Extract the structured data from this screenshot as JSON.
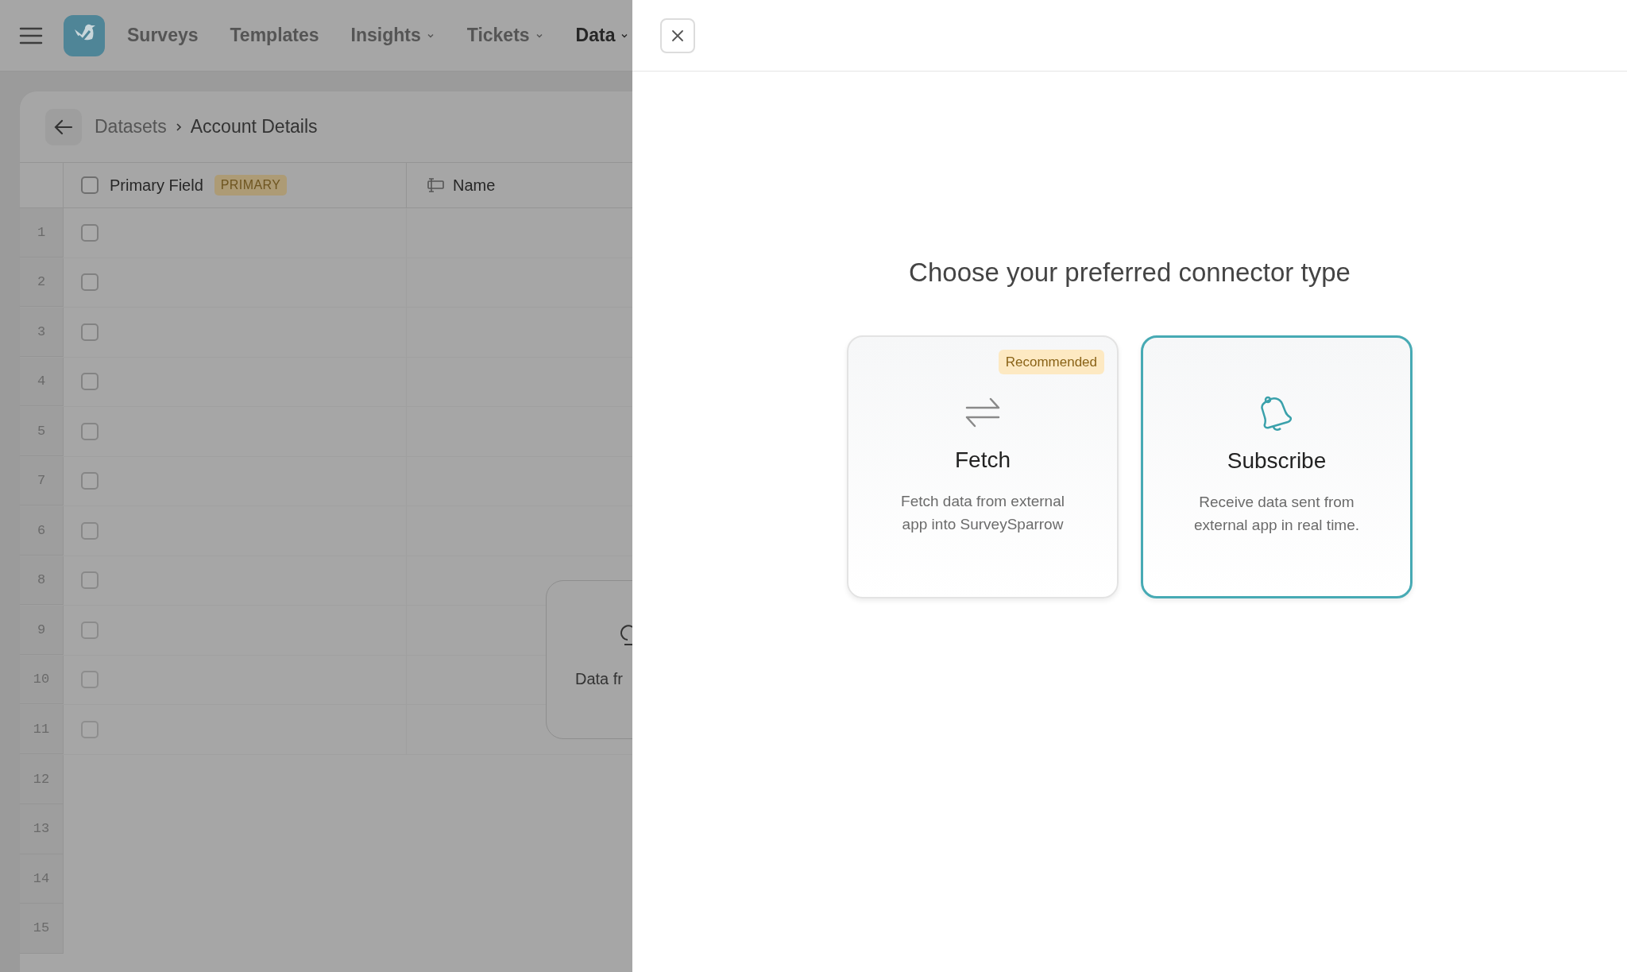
{
  "nav": {
    "items": [
      {
        "label": "Surveys",
        "selected": false,
        "dropdown": false
      },
      {
        "label": "Templates",
        "selected": false,
        "dropdown": false
      },
      {
        "label": "Insights",
        "selected": false,
        "dropdown": true
      },
      {
        "label": "Tickets",
        "selected": false,
        "dropdown": true
      },
      {
        "label": "Data",
        "selected": true,
        "dropdown": true
      }
    ]
  },
  "breadcrumb": [
    "Datasets",
    "Account Details"
  ],
  "table": {
    "columns": [
      {
        "label": "Primary Field",
        "badge": "PRIMARY",
        "kind": "checkbox",
        "checked": false
      },
      {
        "label": "Name",
        "kind": "text"
      }
    ],
    "rows": [
      {
        "number": "1",
        "checked": false
      },
      {
        "number": "2",
        "checked": false
      },
      {
        "number": "3",
        "checked": false
      },
      {
        "number": "4",
        "checked": false
      },
      {
        "number": "5",
        "checked": false
      },
      {
        "number": "7",
        "checked": false
      },
      {
        "number": "6",
        "checked": false
      },
      {
        "number": "8",
        "checked": false
      },
      {
        "number": "9",
        "checked": false
      },
      {
        "number": "10",
        "checked": false
      },
      {
        "number": "11",
        "checked": false
      },
      {
        "number": "12"
      },
      {
        "number": "13"
      },
      {
        "number": "14"
      },
      {
        "number": "15"
      }
    ]
  },
  "background_card": {
    "text": "Data fr"
  },
  "dialog": {
    "title": "Choose your preferred connector type",
    "options": [
      {
        "kind": "fetch",
        "title": "Fetch",
        "description": "Fetch data from external app into SurveySparrow",
        "badge": "Recommended",
        "selected": false
      },
      {
        "kind": "subscribe",
        "title": "Subscribe",
        "description": "Receive data sent from external app in real time.",
        "selected": true
      }
    ]
  }
}
